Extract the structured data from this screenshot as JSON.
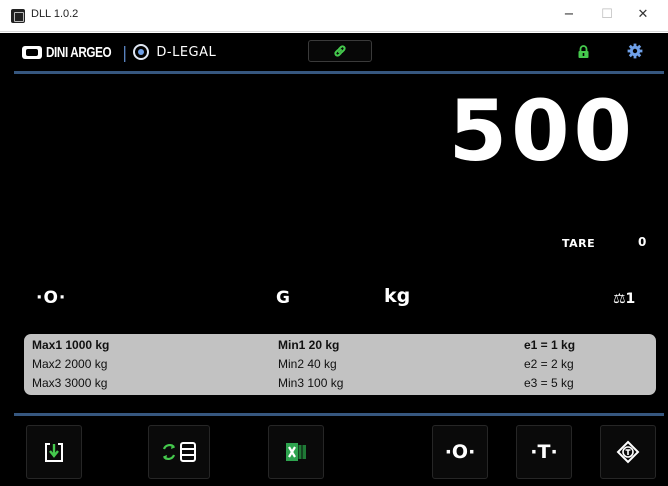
{
  "window": {
    "title": "DLL 1.0.2",
    "minimize_glyph": "−",
    "maximize_glyph": "☐",
    "close_glyph": "✕"
  },
  "header": {
    "brand": "DINI ARGEO",
    "separator": "|",
    "product": "D-LEGAL",
    "link_icon": "link-icon",
    "lock_icon": "lock-icon",
    "settings_icon": "gear-icon"
  },
  "display": {
    "weight": "500",
    "tare_label": "TARE",
    "tare_value": "0",
    "zero_indicator": "·O·",
    "gross_indicator": "G",
    "unit": "kg",
    "range_indicator": "⚖1"
  },
  "ranges": [
    {
      "max": "Max1 1000 kg",
      "min": "Min1 20 kg",
      "e": "e1 = 1 kg",
      "active": true
    },
    {
      "max": "Max2 2000 kg",
      "min": "Min2 40 kg",
      "e": "e2 = 2 kg",
      "active": false
    },
    {
      "max": "Max3 3000 kg",
      "min": "Min3 100 kg",
      "e": "e3 = 5 kg",
      "active": false
    }
  ],
  "toolbar": {
    "import_icon": "import-icon",
    "sync_icon": "sync-database-icon",
    "excel_icon": "excel-icon",
    "zero_label": "·O·",
    "tare_label": "·T·",
    "seal_icon": "seal-icon"
  },
  "colors": {
    "background": "#000000",
    "accent": "#36577f",
    "highlight_green": "#45c94d",
    "settings_blue": "#6fa0e8",
    "panel": "#c2c2c2"
  }
}
